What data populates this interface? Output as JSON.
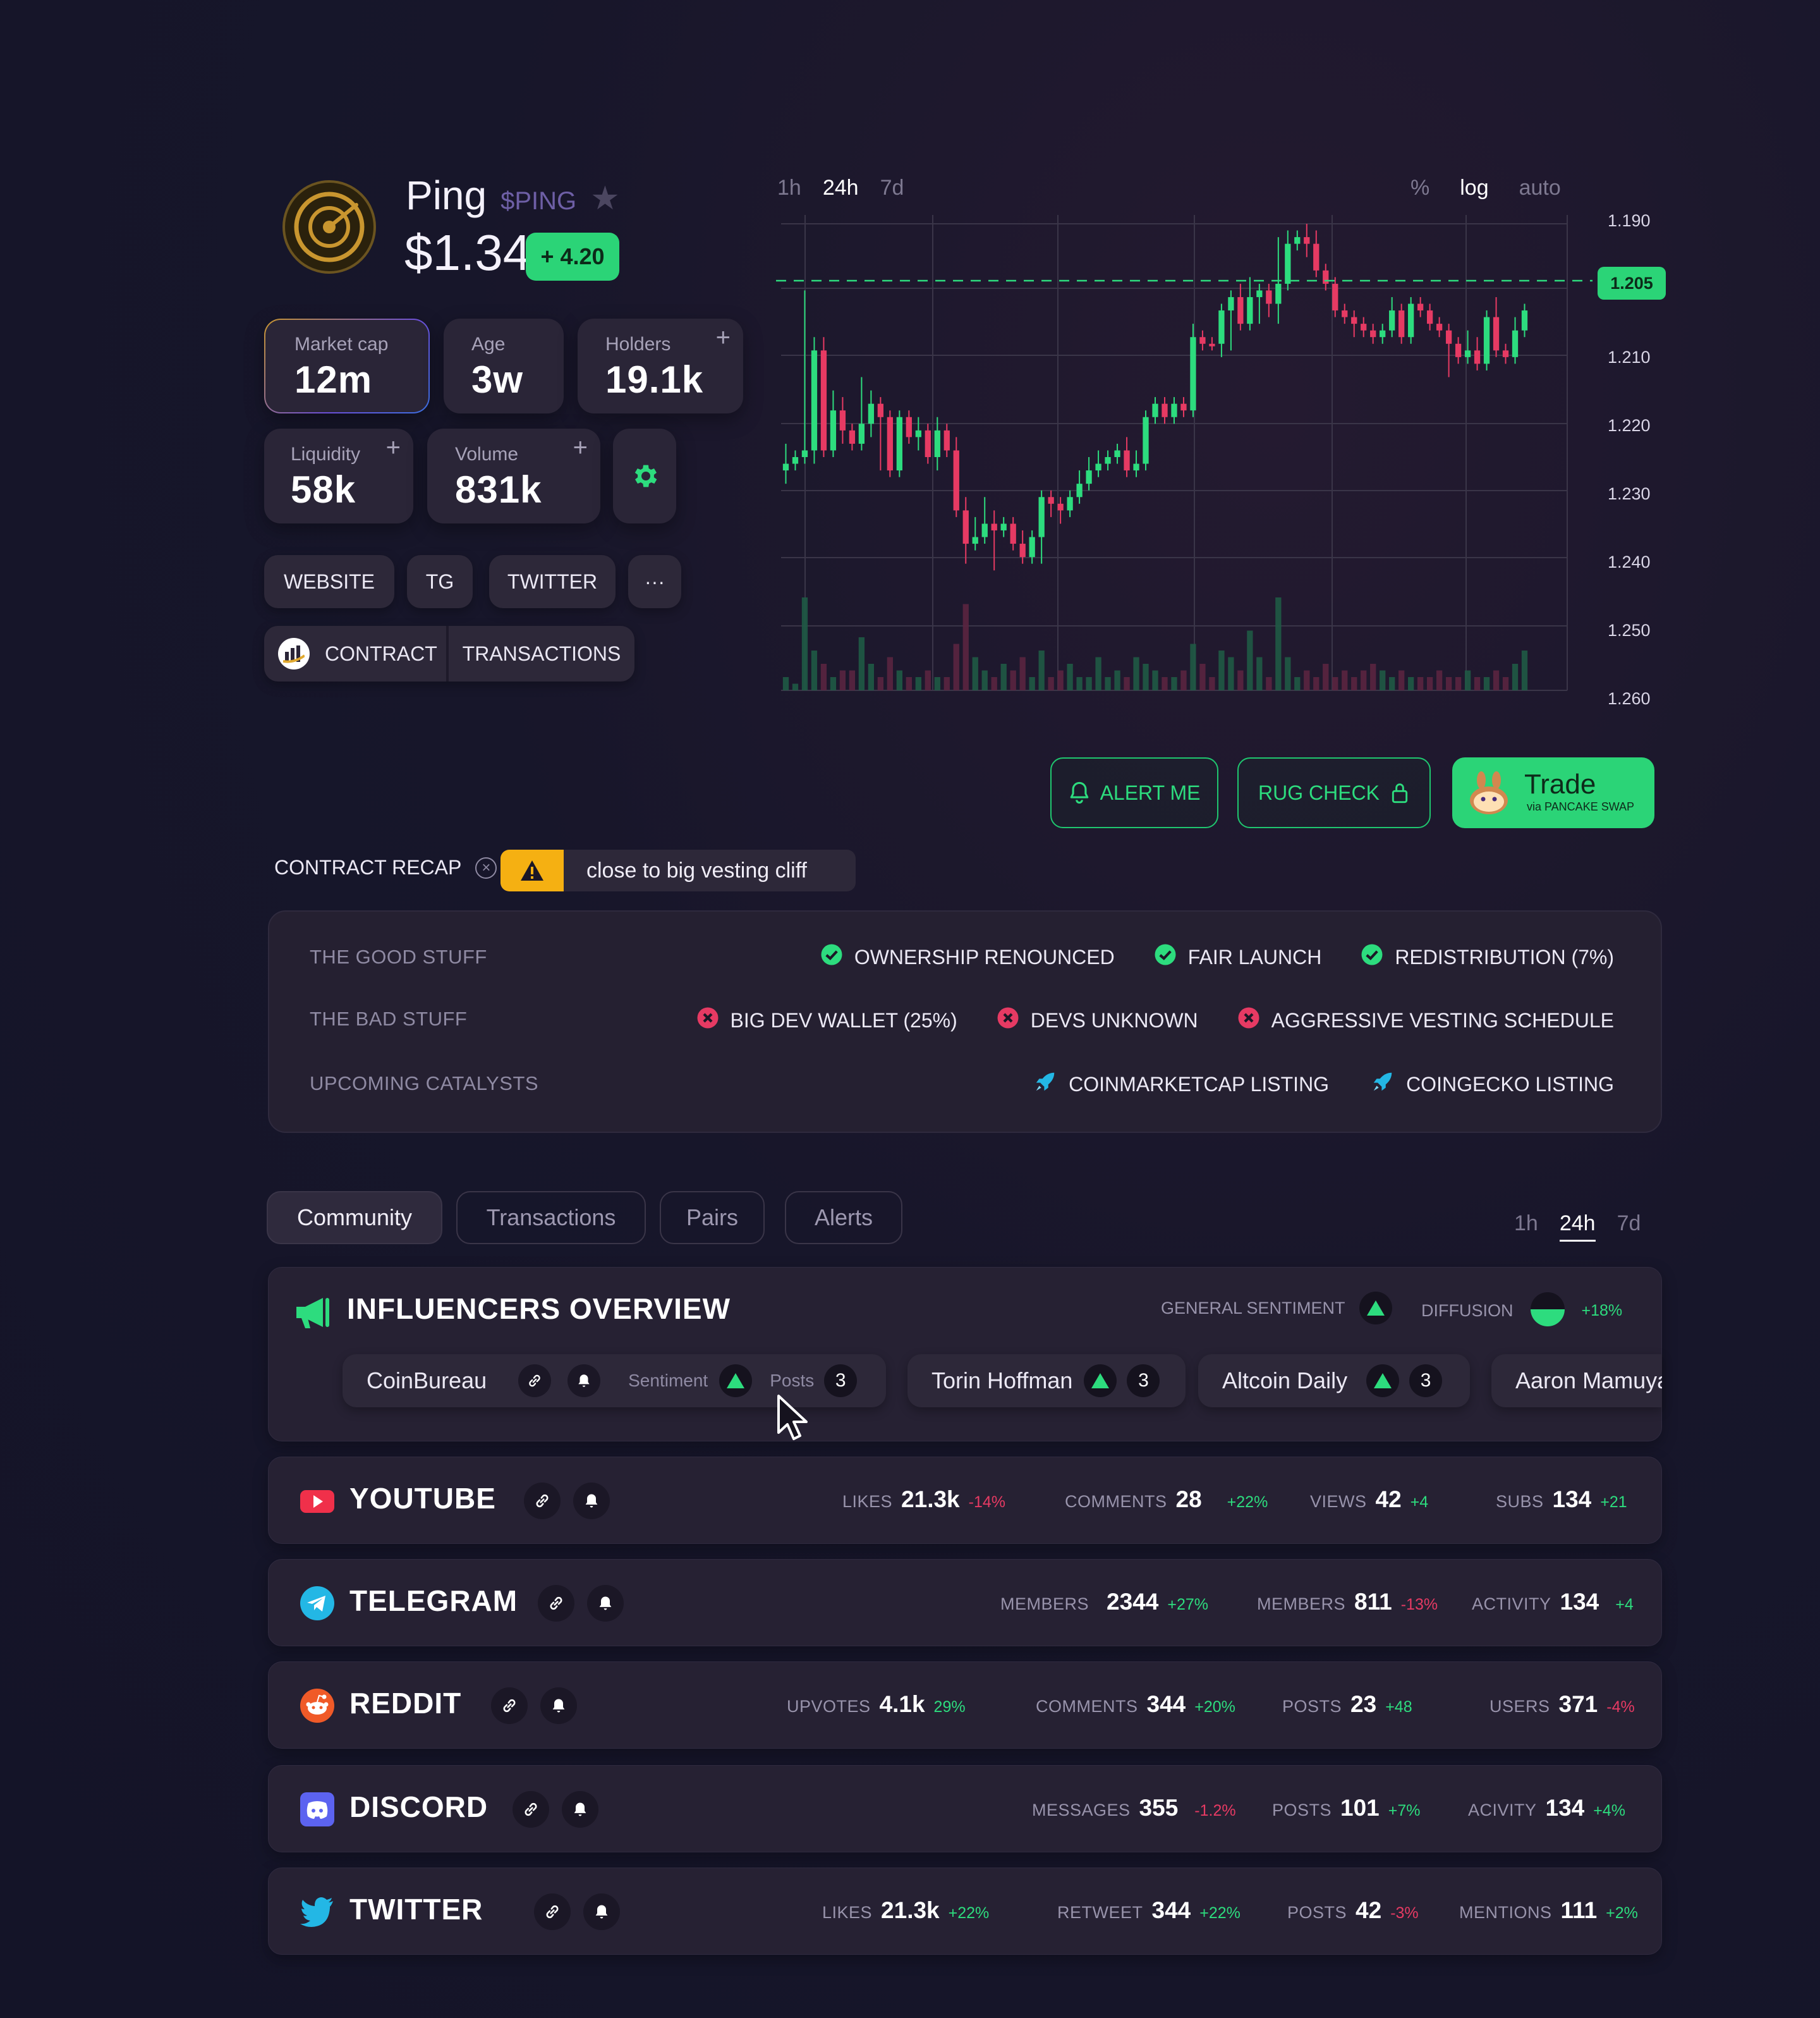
{
  "token": {
    "name": "Ping",
    "ticker": "$PING",
    "price": "$1.34",
    "change": "+ 4.20"
  },
  "stats": [
    {
      "label": "Market cap",
      "value": "12m"
    },
    {
      "label": "Age",
      "value": "3w"
    },
    {
      "label": "Holders",
      "value": "19.1k"
    },
    {
      "label": "Liquidity",
      "value": "58k"
    },
    {
      "label": "Volume",
      "value": "831k"
    }
  ],
  "plus_glyph": "+",
  "links": {
    "website": "WEBSITE",
    "tg": "TG",
    "twitter": "TWITTER",
    "more": "···",
    "contract": "CONTRACT",
    "transactions": "TRANSACTIONS"
  },
  "chart_controls": {
    "timeframes": [
      "1h",
      "24h",
      "7d"
    ],
    "active_timeframe": "24h",
    "scales": [
      "%",
      "log",
      "auto"
    ],
    "active_scale": "log"
  },
  "chart_data": {
    "type": "candlestick",
    "y_labels": [
      "1.190",
      "1.210",
      "1.220",
      "1.230",
      "1.240",
      "1.250",
      "1.260"
    ],
    "current_price_label": "1.205",
    "candles": [
      {
        "o": 1.227,
        "c": 1.226,
        "h": 1.223,
        "l": 1.229,
        "v": 2
      },
      {
        "o": 1.226,
        "c": 1.225,
        "h": 1.224,
        "l": 1.227,
        "v": 1
      },
      {
        "o": 1.225,
        "c": 1.224,
        "h": 1.2,
        "l": 1.226,
        "v": 14
      },
      {
        "o": 1.224,
        "c": 1.209,
        "h": 1.207,
        "l": 1.226,
        "v": 6
      },
      {
        "o": 1.209,
        "c": 1.224,
        "h": 1.207,
        "l": 1.225,
        "v": 4
      },
      {
        "o": 1.224,
        "c": 1.218,
        "h": 1.215,
        "l": 1.225,
        "v": 2
      },
      {
        "o": 1.218,
        "c": 1.221,
        "h": 1.216,
        "l": 1.223,
        "v": 3
      },
      {
        "o": 1.221,
        "c": 1.223,
        "h": 1.22,
        "l": 1.224,
        "v": 3
      },
      {
        "o": 1.223,
        "c": 1.22,
        "h": 1.213,
        "l": 1.224,
        "v": 8
      },
      {
        "o": 1.22,
        "c": 1.217,
        "h": 1.215,
        "l": 1.222,
        "v": 4
      },
      {
        "o": 1.217,
        "c": 1.219,
        "h": 1.216,
        "l": 1.227,
        "v": 2
      },
      {
        "o": 1.219,
        "c": 1.227,
        "h": 1.218,
        "l": 1.228,
        "v": 5
      },
      {
        "o": 1.227,
        "c": 1.219,
        "h": 1.218,
        "l": 1.228,
        "v": 3
      },
      {
        "o": 1.219,
        "c": 1.222,
        "h": 1.218,
        "l": 1.223,
        "v": 2
      },
      {
        "o": 1.222,
        "c": 1.221,
        "h": 1.219,
        "l": 1.224,
        "v": 2
      },
      {
        "o": 1.221,
        "c": 1.225,
        "h": 1.22,
        "l": 1.226,
        "v": 3
      },
      {
        "o": 1.225,
        "c": 1.221,
        "h": 1.219,
        "l": 1.227,
        "v": 2
      },
      {
        "o": 1.221,
        "c": 1.224,
        "h": 1.22,
        "l": 1.225,
        "v": 2
      },
      {
        "o": 1.224,
        "c": 1.233,
        "h": 1.222,
        "l": 1.234,
        "v": 7
      },
      {
        "o": 1.233,
        "c": 1.238,
        "h": 1.231,
        "l": 1.241,
        "v": 13
      },
      {
        "o": 1.238,
        "c": 1.237,
        "h": 1.234,
        "l": 1.239,
        "v": 5
      },
      {
        "o": 1.237,
        "c": 1.235,
        "h": 1.231,
        "l": 1.238,
        "v": 3
      },
      {
        "o": 1.235,
        "c": 1.236,
        "h": 1.233,
        "l": 1.242,
        "v": 2
      },
      {
        "o": 1.236,
        "c": 1.235,
        "h": 1.234,
        "l": 1.237,
        "v": 4
      },
      {
        "o": 1.235,
        "c": 1.238,
        "h": 1.234,
        "l": 1.239,
        "v": 3
      },
      {
        "o": 1.238,
        "c": 1.24,
        "h": 1.236,
        "l": 1.241,
        "v": 5
      },
      {
        "o": 1.24,
        "c": 1.237,
        "h": 1.236,
        "l": 1.241,
        "v": 2
      },
      {
        "o": 1.237,
        "c": 1.231,
        "h": 1.23,
        "l": 1.241,
        "v": 6
      },
      {
        "o": 1.231,
        "c": 1.232,
        "h": 1.23,
        "l": 1.234,
        "v": 2
      },
      {
        "o": 1.232,
        "c": 1.233,
        "h": 1.231,
        "l": 1.235,
        "v": 3
      },
      {
        "o": 1.233,
        "c": 1.231,
        "h": 1.23,
        "l": 1.234,
        "v": 4
      },
      {
        "o": 1.231,
        "c": 1.229,
        "h": 1.227,
        "l": 1.232,
        "v": 2
      },
      {
        "o": 1.229,
        "c": 1.227,
        "h": 1.225,
        "l": 1.23,
        "v": 2
      },
      {
        "o": 1.227,
        "c": 1.226,
        "h": 1.224,
        "l": 1.228,
        "v": 5
      },
      {
        "o": 1.226,
        "c": 1.225,
        "h": 1.224,
        "l": 1.227,
        "v": 2
      },
      {
        "o": 1.225,
        "c": 1.224,
        "h": 1.223,
        "l": 1.226,
        "v": 3
      },
      {
        "o": 1.224,
        "c": 1.227,
        "h": 1.222,
        "l": 1.228,
        "v": 2
      },
      {
        "o": 1.227,
        "c": 1.226,
        "h": 1.224,
        "l": 1.228,
        "v": 5
      },
      {
        "o": 1.226,
        "c": 1.219,
        "h": 1.218,
        "l": 1.227,
        "v": 4
      },
      {
        "o": 1.219,
        "c": 1.217,
        "h": 1.216,
        "l": 1.22,
        "v": 3
      },
      {
        "o": 1.217,
        "c": 1.219,
        "h": 1.216,
        "l": 1.22,
        "v": 2
      },
      {
        "o": 1.219,
        "c": 1.217,
        "h": 1.216,
        "l": 1.22,
        "v": 2
      },
      {
        "o": 1.217,
        "c": 1.218,
        "h": 1.216,
        "l": 1.219,
        "v": 3
      },
      {
        "o": 1.218,
        "c": 1.207,
        "h": 1.205,
        "l": 1.219,
        "v": 7
      },
      {
        "o": 1.207,
        "c": 1.208,
        "h": 1.206,
        "l": 1.209,
        "v": 4
      },
      {
        "o": 1.208,
        "c": 1.208,
        "h": 1.207,
        "l": 1.209,
        "v": 2
      },
      {
        "o": 1.208,
        "c": 1.203,
        "h": 1.202,
        "l": 1.21,
        "v": 6
      },
      {
        "o": 1.203,
        "c": 1.201,
        "h": 1.2,
        "l": 1.209,
        "v": 5
      },
      {
        "o": 1.201,
        "c": 1.205,
        "h": 1.199,
        "l": 1.206,
        "v": 3
      },
      {
        "o": 1.205,
        "c": 1.201,
        "h": 1.198,
        "l": 1.206,
        "v": 9
      },
      {
        "o": 1.201,
        "c": 1.2,
        "h": 1.199,
        "l": 1.205,
        "v": 5
      },
      {
        "o": 1.2,
        "c": 1.202,
        "h": 1.199,
        "l": 1.204,
        "v": 2
      },
      {
        "o": 1.202,
        "c": 1.199,
        "h": 1.192,
        "l": 1.205,
        "v": 14
      },
      {
        "o": 1.199,
        "c": 1.193,
        "h": 1.191,
        "l": 1.2,
        "v": 5
      },
      {
        "o": 1.193,
        "c": 1.192,
        "h": 1.191,
        "l": 1.194,
        "v": 2
      },
      {
        "o": 1.192,
        "c": 1.193,
        "h": 1.19,
        "l": 1.195,
        "v": 3
      },
      {
        "o": 1.193,
        "c": 1.197,
        "h": 1.191,
        "l": 1.198,
        "v": 2
      },
      {
        "o": 1.197,
        "c": 1.199,
        "h": 1.196,
        "l": 1.2,
        "v": 4
      },
      {
        "o": 1.199,
        "c": 1.203,
        "h": 1.198,
        "l": 1.204,
        "v": 2
      },
      {
        "o": 1.203,
        "c": 1.204,
        "h": 1.202,
        "l": 1.205,
        "v": 3
      },
      {
        "o": 1.204,
        "c": 1.205,
        "h": 1.203,
        "l": 1.207,
        "v": 2
      },
      {
        "o": 1.205,
        "c": 1.206,
        "h": 1.204,
        "l": 1.207,
        "v": 3
      },
      {
        "o": 1.206,
        "c": 1.207,
        "h": 1.205,
        "l": 1.208,
        "v": 4
      },
      {
        "o": 1.207,
        "c": 1.206,
        "h": 1.205,
        "l": 1.208,
        "v": 3
      },
      {
        "o": 1.206,
        "c": 1.203,
        "h": 1.201,
        "l": 1.207,
        "v": 2
      },
      {
        "o": 1.203,
        "c": 1.207,
        "h": 1.202,
        "l": 1.208,
        "v": 3
      },
      {
        "o": 1.207,
        "c": 1.202,
        "h": 1.201,
        "l": 1.208,
        "v": 2
      },
      {
        "o": 1.202,
        "c": 1.203,
        "h": 1.201,
        "l": 1.204,
        "v": 2
      },
      {
        "o": 1.203,
        "c": 1.205,
        "h": 1.202,
        "l": 1.206,
        "v": 2
      },
      {
        "o": 1.205,
        "c": 1.206,
        "h": 1.204,
        "l": 1.207,
        "v": 3
      },
      {
        "o": 1.206,
        "c": 1.208,
        "h": 1.205,
        "l": 1.213,
        "v": 2
      },
      {
        "o": 1.208,
        "c": 1.21,
        "h": 1.207,
        "l": 1.211,
        "v": 2
      },
      {
        "o": 1.21,
        "c": 1.209,
        "h": 1.206,
        "l": 1.211,
        "v": 3
      },
      {
        "o": 1.209,
        "c": 1.211,
        "h": 1.207,
        "l": 1.212,
        "v": 2
      },
      {
        "o": 1.211,
        "c": 1.204,
        "h": 1.203,
        "l": 1.212,
        "v": 2
      },
      {
        "o": 1.204,
        "c": 1.209,
        "h": 1.201,
        "l": 1.21,
        "v": 3
      },
      {
        "o": 1.209,
        "c": 1.21,
        "h": 1.208,
        "l": 1.211,
        "v": 2
      },
      {
        "o": 1.21,
        "c": 1.206,
        "h": 1.204,
        "l": 1.211,
        "v": 4
      },
      {
        "o": 1.206,
        "c": 1.203,
        "h": 1.202,
        "l": 1.207,
        "v": 6
      }
    ]
  },
  "actions": {
    "alert": "ALERT ME",
    "rug_check": "RUG CHECK",
    "trade": "Trade",
    "trade_sub": "via PANCAKE SWAP"
  },
  "recap": {
    "title": "CONTRACT RECAP",
    "warning": "close to big vesting cliff",
    "good_label": "THE GOOD STUFF",
    "good": [
      "OWNERSHIP RENOUNCED",
      "FAIR LAUNCH",
      "REDISTRIBUTION  (7%)"
    ],
    "bad_label": "THE BAD STUFF",
    "bad": [
      "BIG DEV WALLET (25%)",
      "DEVS UNKNOWN",
      "AGGRESSIVE VESTING SCHEDULE"
    ],
    "catalysts_label": "UPCOMING CATALYSTS",
    "catalysts": [
      "COINMARKETCAP LISTING",
      "COINGECKO LISTING"
    ]
  },
  "tabs": [
    "Community",
    "Transactions",
    "Pairs",
    "Alerts"
  ],
  "active_tab": "Community",
  "community_timeframes": [
    "1h",
    "24h",
    "7d"
  ],
  "influencers": {
    "title": "INFLUENCERS OVERVIEW",
    "general_sentiment": "GENERAL SENTIMENT",
    "diffusion": "DIFFUSION",
    "diffusion_value": "+18%",
    "chips": [
      {
        "name": "CoinBureau",
        "sentiment_label": "Sentiment",
        "posts_label": "Posts",
        "posts": "3"
      },
      {
        "name": "Torin Hoffman",
        "posts": "3"
      },
      {
        "name": "Altcoin Daily",
        "posts": "3"
      },
      {
        "name": "Aaron Mamuya"
      }
    ]
  },
  "socials": [
    {
      "name": "YOUTUBE",
      "metrics": [
        {
          "k": "LIKES",
          "v": "21.3k",
          "d": "-14%",
          "neg": true
        },
        {
          "k": "COMMENTS",
          "v": "28",
          "d": "+22%"
        },
        {
          "k": "VIEWS",
          "v": "42",
          "d": "+4"
        },
        {
          "k": "SUBS",
          "v": "134",
          "d": "+21"
        }
      ]
    },
    {
      "name": "TELEGRAM",
      "metrics": [
        {
          "k": "MEMBERS",
          "v": "2344",
          "d": "+27%"
        },
        {
          "k": "MEMBERS",
          "v": "811",
          "d": "-13%",
          "neg": true
        },
        {
          "k": "ACTIVITY",
          "v": "134",
          "d": "+4"
        }
      ]
    },
    {
      "name": "REDDIT",
      "metrics": [
        {
          "k": "UPVOTES",
          "v": "4.1k",
          "d": "29%"
        },
        {
          "k": "COMMENTS",
          "v": "344",
          "d": "+20%"
        },
        {
          "k": "POSTS",
          "v": "23",
          "d": "+48"
        },
        {
          "k": "USERS",
          "v": "371",
          "d": "-4%",
          "neg": true
        }
      ]
    },
    {
      "name": "DISCORD",
      "metrics": [
        {
          "k": "MESSAGES",
          "v": "355",
          "d": "-1.2%",
          "neg": true
        },
        {
          "k": "POSTS",
          "v": "101",
          "d": "+7%"
        },
        {
          "k": "ACIVITY",
          "v": "134",
          "d": "+4%"
        }
      ]
    },
    {
      "name": "TWITTER",
      "metrics": [
        {
          "k": "LIKES",
          "v": "21.3k",
          "d": "+22%"
        },
        {
          "k": "RETWEET",
          "v": "344",
          "d": "+22%"
        },
        {
          "k": "POSTS",
          "v": "42",
          "d": "-3%",
          "neg": true
        },
        {
          "k": "MENTIONS",
          "v": "111",
          "d": "+2%"
        }
      ]
    }
  ],
  "colors": {
    "up": "#2ddc7e",
    "down": "#e63a63",
    "accent": "#2bd477"
  }
}
